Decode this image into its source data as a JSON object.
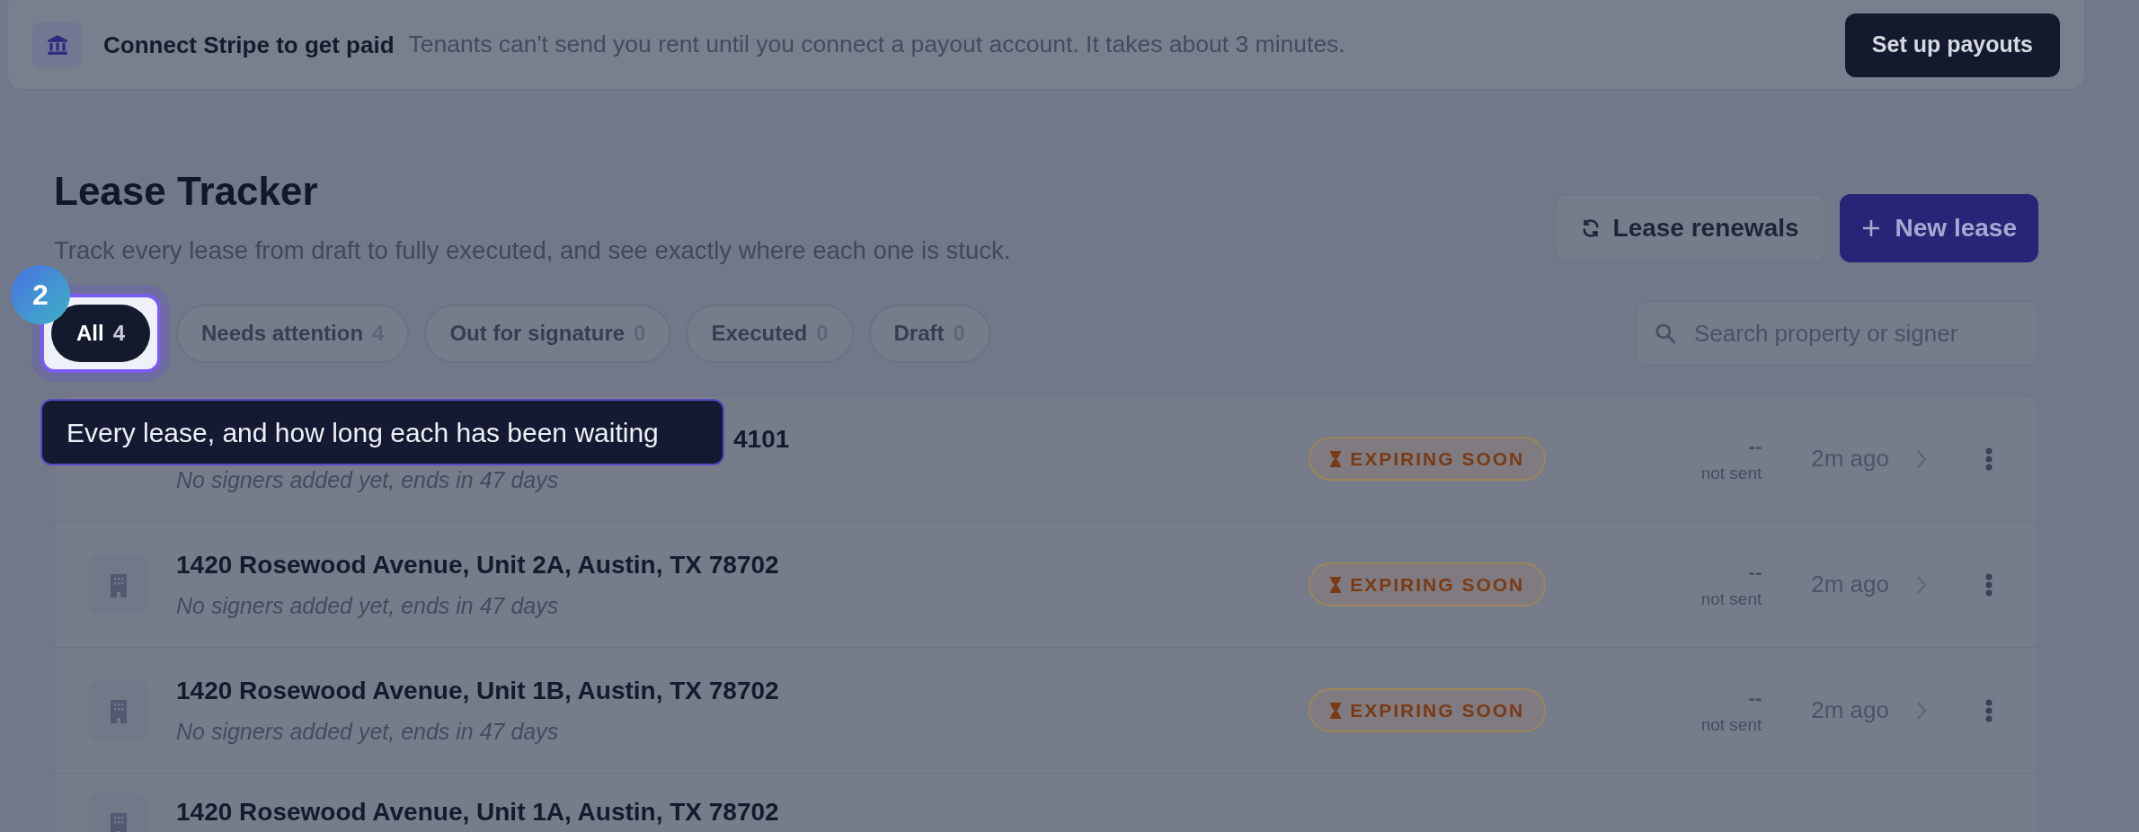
{
  "banner": {
    "title": "Connect Stripe to get paid",
    "message": "Tenants can't send you rent until you connect a payout account. It takes about 3 minutes.",
    "button": "Set up payouts"
  },
  "header": {
    "title": "Lease Tracker",
    "subtitle": "Track every lease from draft to fully executed, and see exactly where each one is stuck.",
    "actions": [
      {
        "label": "Lease renewals",
        "kind": "secondary"
      },
      {
        "label": "New lease",
        "kind": "primary"
      }
    ]
  },
  "tabs": [
    {
      "label": "All",
      "count": "4",
      "selected": true
    },
    {
      "label": "Needs attention",
      "count": "4",
      "selected": false
    },
    {
      "label": "Out for signature",
      "count": "0",
      "selected": false
    },
    {
      "label": "Executed",
      "count": "0",
      "selected": false
    },
    {
      "label": "Draft",
      "count": "0",
      "selected": false
    }
  ],
  "search": {
    "placeholder": "Search property or signer"
  },
  "tour": {
    "step": "2",
    "tooltip": "Every lease, and how long each has been waiting"
  },
  "rows": [
    {
      "title": "4101",
      "subtitle": "No signers added yet, ends in 47 days",
      "partly_covered": true,
      "status": "EXPIRING SOON",
      "signers": "--",
      "signers_note": "not sent",
      "updated": "2m ago"
    },
    {
      "title": "1420 Rosewood Avenue, Unit 2A, Austin, TX 78702",
      "subtitle": "No signers added yet, ends in 47 days",
      "partly_covered": false,
      "status": "EXPIRING SOON",
      "signers": "--",
      "signers_note": "not sent",
      "updated": "2m ago"
    },
    {
      "title": "1420 Rosewood Avenue, Unit 1B, Austin, TX 78702",
      "subtitle": "No signers added yet, ends in 47 days",
      "partly_covered": false,
      "status": "EXPIRING SOON",
      "signers": "--",
      "signers_note": "not sent",
      "updated": "2m ago"
    },
    {
      "title": "1420 Rosewood Avenue, Unit 1A, Austin, TX 78702",
      "partly_covered": false
    }
  ]
}
